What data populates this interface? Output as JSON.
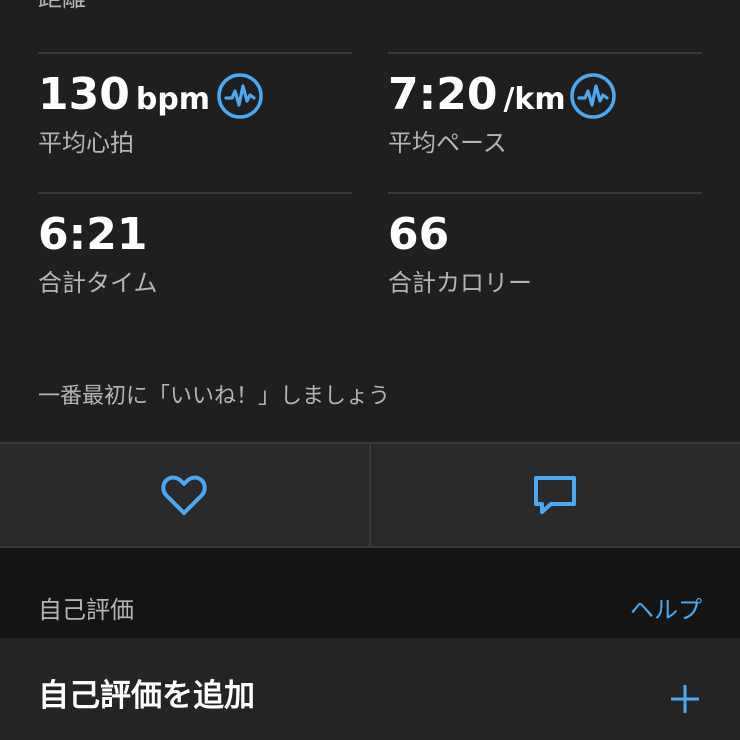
{
  "top_section": {
    "label": "距離"
  },
  "stats": [
    {
      "value": "130",
      "unit": "bpm",
      "label": "平均心拍",
      "icon": "heart-rate-icon"
    },
    {
      "value": "7:20",
      "unit": "/km",
      "label": "平均ペース",
      "icon": "heart-rate-icon"
    },
    {
      "value": "6:21",
      "unit": "",
      "label": "合計タイム"
    },
    {
      "value": "66",
      "unit": "",
      "label": "合計カロリー"
    }
  ],
  "social": {
    "like_prompt": "一番最初に「いいね！」しましょう",
    "like_icon": "heart-outline-icon",
    "comment_icon": "comment-icon"
  },
  "self_evaluation": {
    "title": "自己評価",
    "help_label": "ヘルプ",
    "add_label": "自己評価を追加",
    "add_icon": "plus-icon"
  },
  "colors": {
    "background": "#1f1f1f",
    "accent": "#4ca8f0",
    "secondary_text": "#b4b4b4",
    "divider": "#3a3a3a"
  }
}
